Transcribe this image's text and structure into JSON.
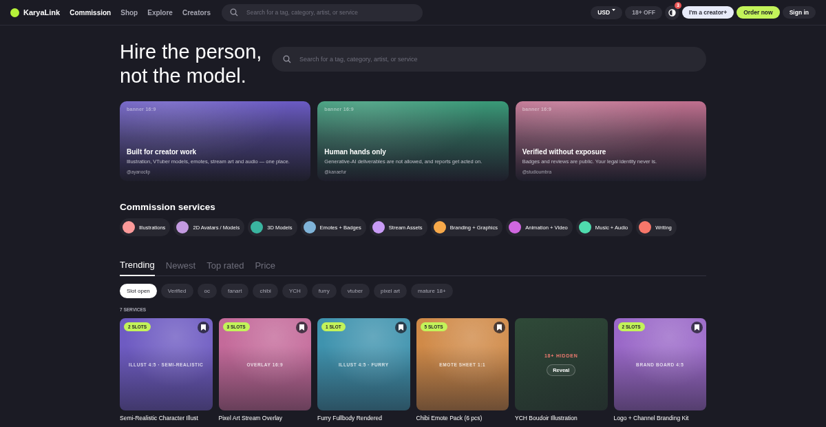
{
  "nav": {
    "logo": "KaryaLink",
    "links": [
      {
        "label": "Commission",
        "selected": true
      },
      {
        "label": "Shop",
        "selected": false
      },
      {
        "label": "Explore",
        "selected": false
      },
      {
        "label": "Creators",
        "selected": false
      }
    ],
    "search": {
      "placeholder": "Search for a tag, category, artist, or service"
    },
    "currency": "USD",
    "age_filter": "18+ OFF",
    "notification_count": "3",
    "buttons": [
      {
        "label": "I'm a creator+",
        "kind": "light"
      },
      {
        "label": "Order now",
        "kind": "primary"
      },
      {
        "label": "Sign in",
        "kind": "dark"
      }
    ]
  },
  "hero": {
    "title_lines": [
      "Hire the person,",
      "not the model."
    ],
    "search": {
      "placeholder": "Search for a tag, category, artist, or service"
    }
  },
  "banners": [
    {
      "tag": "banner 16:9",
      "title": "Built for creator work",
      "text": "Illustration, VTuber models, emotes, stream art and audio — one place.",
      "handle": "@ayanoclip",
      "color": "#6b5bc4"
    },
    {
      "tag": "banner 16:9",
      "title": "Human hands only",
      "text": "Generative-AI deliverables are not allowed, and reports get acted on.",
      "handle": "@kanaefur",
      "color": "#3a9a78"
    },
    {
      "tag": "banner 16:9",
      "title": "Verified without exposure",
      "text": "Badges and reviews are public. Your legal identity never is.",
      "handle": "@studioumbra",
      "color": "#c0708f"
    }
  ],
  "services": {
    "heading": "Commission services",
    "items": [
      {
        "label": "Illustrations",
        "color": "#fb9a9a"
      },
      {
        "label": "2D Avatars / Models",
        "color": "#c39ae0"
      },
      {
        "label": "3D Models",
        "color": "#3ab5a0"
      },
      {
        "label": "Emotes + Badges",
        "color": "#7fb3d8"
      },
      {
        "label": "Stream Assets",
        "color": "#c89bf5"
      },
      {
        "label": "Branding + Graphics",
        "color": "#f7a94a"
      },
      {
        "label": "Animation + Video",
        "color": "#d067e0"
      },
      {
        "label": "Music + Audio",
        "color": "#4fdcae"
      },
      {
        "label": "Writing",
        "color": "#f7776a"
      }
    ]
  },
  "tabs": [
    {
      "label": "Trending",
      "selected": true
    },
    {
      "label": "Newest",
      "selected": false
    },
    {
      "label": "Top rated",
      "selected": false
    },
    {
      "label": "Price",
      "selected": false
    }
  ],
  "filters": [
    {
      "label": "Slot open",
      "selected": true
    },
    {
      "label": "Verified",
      "selected": false
    },
    {
      "label": "oc",
      "selected": false
    },
    {
      "label": "fanart",
      "selected": false
    },
    {
      "label": "chibi",
      "selected": false
    },
    {
      "label": "YCH",
      "selected": false
    },
    {
      "label": "furry",
      "selected": false
    },
    {
      "label": "vtuber",
      "selected": false
    },
    {
      "label": "pixel art",
      "selected": false
    },
    {
      "label": "mature 18+",
      "selected": false
    }
  ],
  "count": "7 SERVICES",
  "cards": [
    {
      "kind": "normal",
      "slots": "2 SLOTS",
      "art_label": "ILLUST 4:5 · SEMI-REALISTIC",
      "title": "Semi-Realistic Character Illust",
      "color": "#6e5bc2"
    },
    {
      "kind": "normal",
      "slots": "3 SLOTS",
      "art_label": "OVERLAY 16:9",
      "title": "Pixel Art Stream Overlay",
      "color": "#c46a9a"
    },
    {
      "kind": "normal",
      "slots": "1 SLOT",
      "art_label": "ILLUST 4:5 · FURRY",
      "title": "Furry Fullbody Rendered",
      "color": "#3f93ae"
    },
    {
      "kind": "normal",
      "slots": "5 SLOTS",
      "art_label": "EMOTE SHEET 1:1",
      "title": "Chibi Emote Pack (6 pcs)",
      "color": "#d08a48"
    },
    {
      "kind": "hidden",
      "hidden_label": "18+ HIDDEN",
      "reveal": "Reveal",
      "title": "YCH Boudoir Illustration",
      "color": "#2f4a38"
    },
    {
      "kind": "normal",
      "slots": "2 SLOTS",
      "art_label": "BRAND BOARD 4:5",
      "title": "Logo + Channel Branding Kit",
      "color": "#9a68c8"
    }
  ]
}
